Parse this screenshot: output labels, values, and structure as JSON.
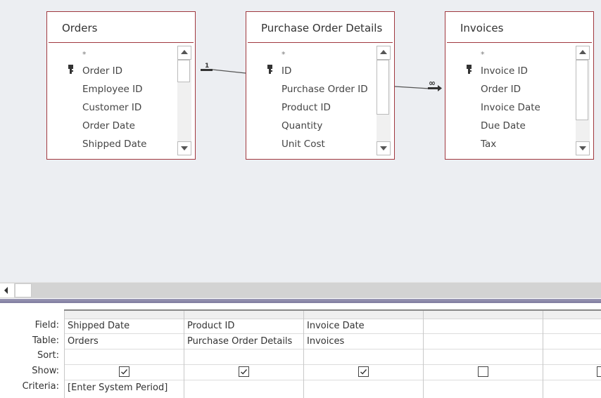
{
  "diagram": {
    "tables": [
      {
        "name": "Orders",
        "fields": [
          "*",
          "Order ID",
          "Employee ID",
          "Customer ID",
          "Order Date",
          "Shipped Date"
        ],
        "primary_key": "Order ID"
      },
      {
        "name": "Purchase Order Details",
        "fields": [
          "*",
          "ID",
          "Purchase Order ID",
          "Product ID",
          "Quantity",
          "Unit Cost"
        ],
        "primary_key": "ID"
      },
      {
        "name": "Invoices",
        "fields": [
          "*",
          "Invoice ID",
          "Order ID",
          "Invoice Date",
          "Due Date",
          "Tax"
        ],
        "primary_key": "Invoice ID"
      }
    ],
    "relationships": [
      {
        "from": "Orders",
        "to": "Purchase Order Details",
        "label_from": "1"
      },
      {
        "from": "Purchase Order Details",
        "to": "Invoices",
        "label_to": "∞"
      }
    ]
  },
  "grid": {
    "row_labels": [
      "Field:",
      "Table:",
      "Sort:",
      "Show:",
      "Criteria:"
    ],
    "columns": [
      {
        "field": "Shipped Date",
        "table": "Orders",
        "sort": "",
        "show": true,
        "criteria": "[Enter System Period]"
      },
      {
        "field": "Product ID",
        "table": "Purchase Order Details",
        "sort": "",
        "show": true,
        "criteria": ""
      },
      {
        "field": "Invoice Date",
        "table": "Invoices",
        "sort": "",
        "show": true,
        "criteria": ""
      },
      {
        "field": "",
        "table": "",
        "sort": "",
        "show": false,
        "criteria": ""
      },
      {
        "field": "",
        "table": "",
        "sort": "",
        "show": false,
        "criteria": ""
      }
    ]
  },
  "colors": {
    "table_border": "#a0383f",
    "canvas_background": "#eceef2",
    "splitter": "#8a87a8"
  }
}
